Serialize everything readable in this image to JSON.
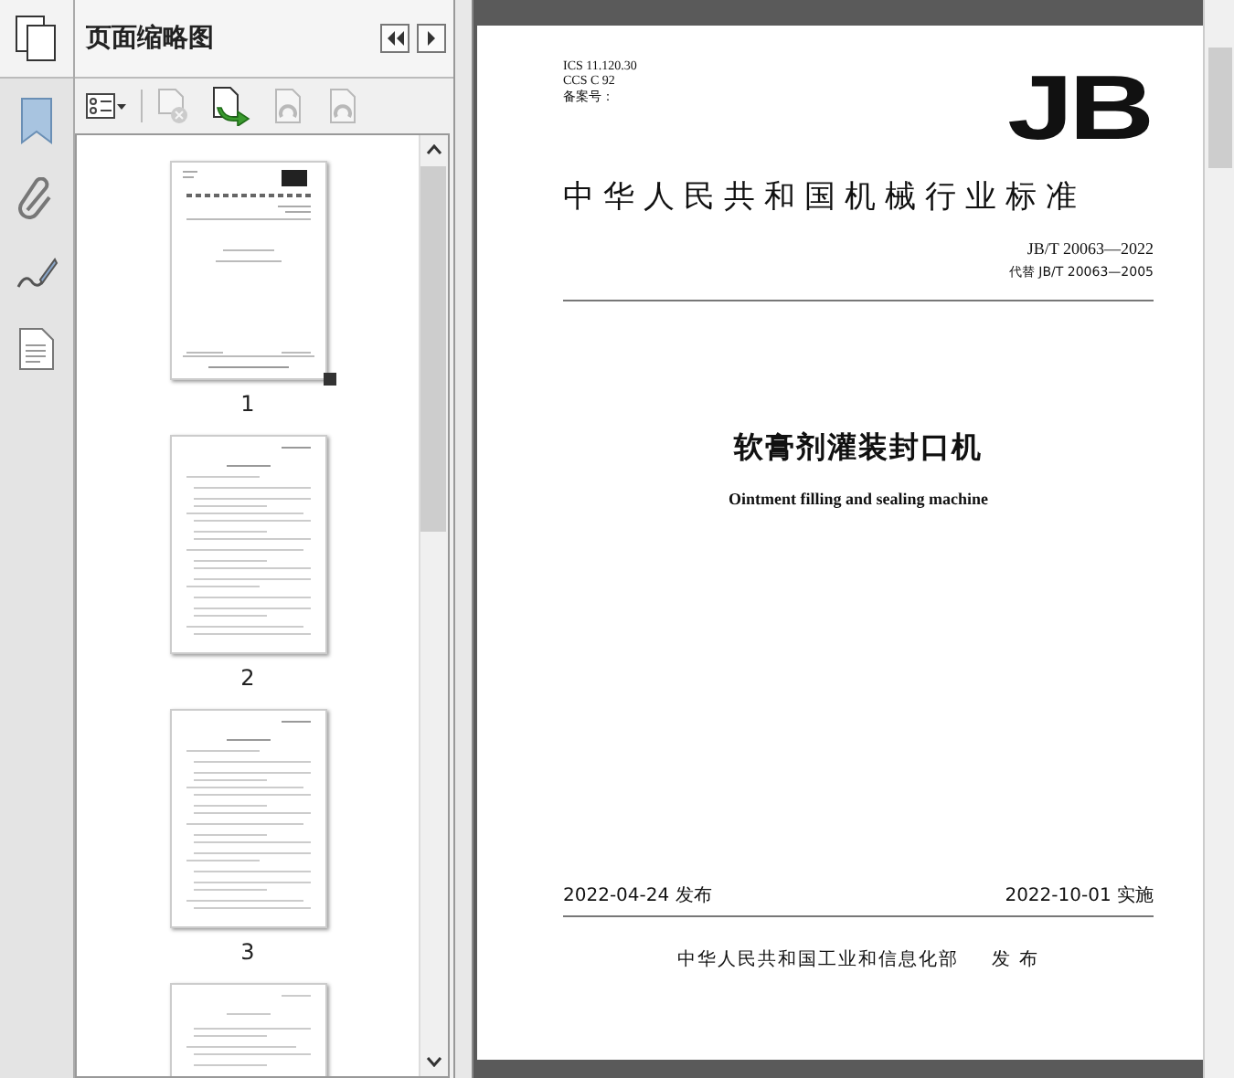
{
  "panel": {
    "title": "页面缩略图"
  },
  "toolbar": [
    {
      "kind": "options",
      "disabled": false
    },
    {
      "kind": "delete",
      "disabled": true
    },
    {
      "kind": "insert",
      "disabled": false
    },
    {
      "kind": "rotate",
      "disabled": true
    },
    {
      "kind": "rotate",
      "disabled": true
    }
  ],
  "thumbnails": [
    {
      "label": "1",
      "selected": true,
      "kind": "cover"
    },
    {
      "label": "2",
      "selected": false,
      "kind": "text"
    },
    {
      "label": "3",
      "selected": false,
      "kind": "text"
    }
  ],
  "document": {
    "codes": [
      "ICS 11.120.30",
      "CCS C 92",
      "备案号："
    ],
    "logo": "JB",
    "heading": "中华人民共和国机械行业标准",
    "standard_number": "JB/T 20063—2022",
    "replaces": "代替 JB/T 20063—2005",
    "title": "软膏剂灌装封口机",
    "english_title": "Ointment filling and sealing machine",
    "issue_date": "2022-04-24 发布",
    "effective_date": "2022-10-01 实施",
    "issuer": "中华人民共和国工业和信息化部",
    "issuer_action": "发 布"
  }
}
